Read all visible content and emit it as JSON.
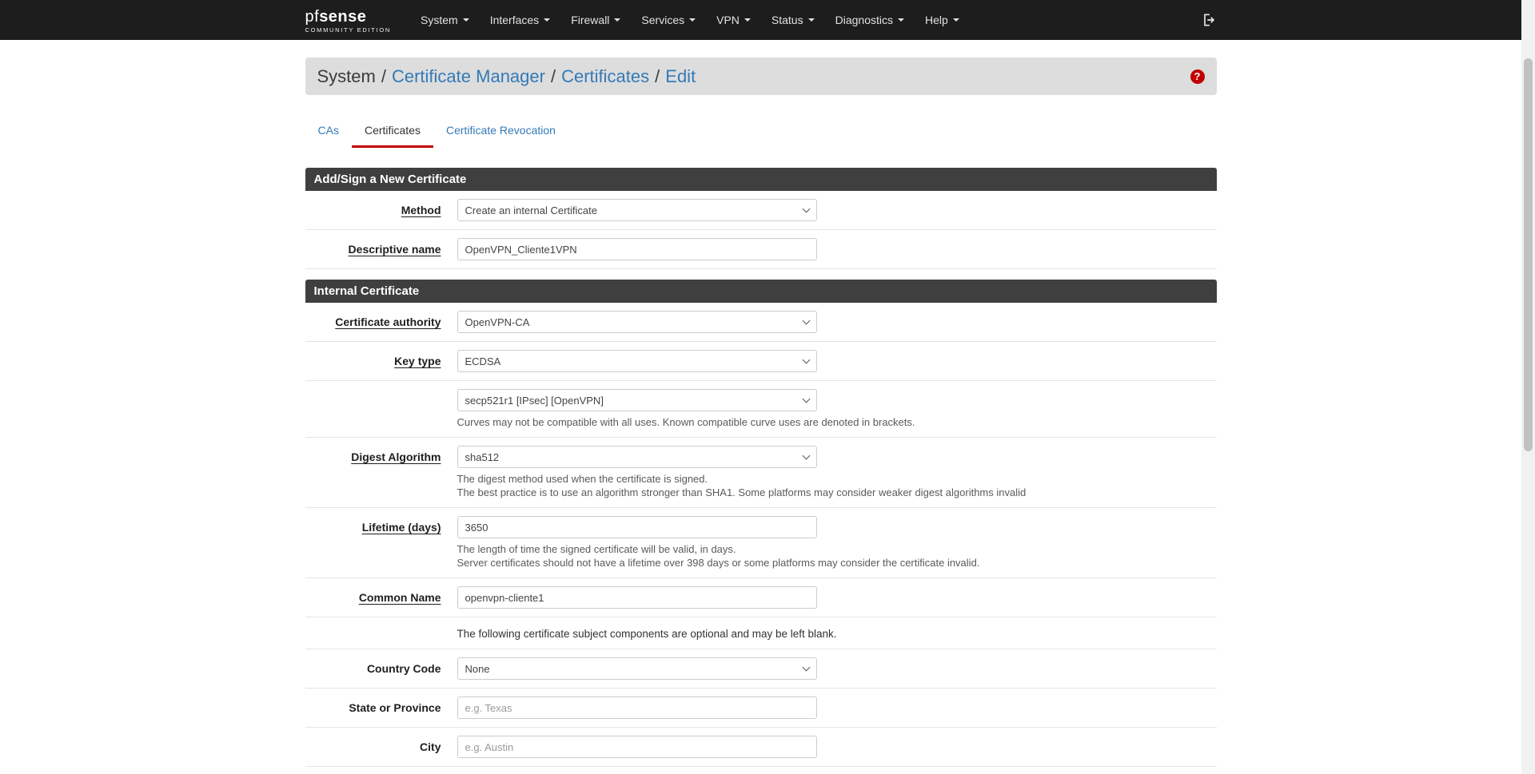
{
  "brand": {
    "name_a": "pf",
    "name_b": "sense",
    "tagline": "COMMUNITY EDITION"
  },
  "nav": {
    "items": [
      "System",
      "Interfaces",
      "Firewall",
      "Services",
      "VPN",
      "Status",
      "Diagnostics",
      "Help"
    ]
  },
  "breadcrumb": {
    "section": "System",
    "sep": "/",
    "crumb1": "Certificate Manager",
    "crumb2": "Certificates",
    "crumb3": "Edit",
    "help_glyph": "?"
  },
  "tabs": {
    "items": [
      "CAs",
      "Certificates",
      "Certificate Revocation"
    ],
    "active": "Certificates"
  },
  "panel_add": {
    "title": "Add/Sign a New Certificate",
    "method": {
      "label": "Method",
      "value": "Create an internal Certificate"
    },
    "descriptive_name": {
      "label": "Descriptive name",
      "value": "OpenVPN_Cliente1VPN"
    }
  },
  "panel_internal": {
    "title": "Internal Certificate",
    "certificate_authority": {
      "label": "Certificate authority",
      "value": "OpenVPN-CA"
    },
    "key_type": {
      "label": "Key type",
      "value": "ECDSA"
    },
    "curve": {
      "value": "secp521r1 [IPsec] [OpenVPN]",
      "help": "Curves may not be compatible with all uses. Known compatible curve uses are denoted in brackets."
    },
    "digest": {
      "label": "Digest Algorithm",
      "value": "sha512",
      "help1": "The digest method used when the certificate is signed.",
      "help2": "The best practice is to use an algorithm stronger than SHA1. Some platforms may consider weaker digest algorithms invalid"
    },
    "lifetime": {
      "label": "Lifetime (days)",
      "value": "3650",
      "help1": "The length of time the signed certificate will be valid, in days.",
      "help2": "Server certificates should not have a lifetime over 398 days or some platforms may consider the certificate invalid."
    },
    "common_name": {
      "label": "Common Name",
      "value": "openvpn-cliente1"
    },
    "subject_note": "The following certificate subject components are optional and may be left blank.",
    "country_code": {
      "label": "Country Code",
      "value": "None"
    },
    "state": {
      "label": "State or Province",
      "placeholder": "e.g. Texas"
    },
    "city": {
      "label": "City",
      "placeholder": "e.g. Austin"
    }
  }
}
